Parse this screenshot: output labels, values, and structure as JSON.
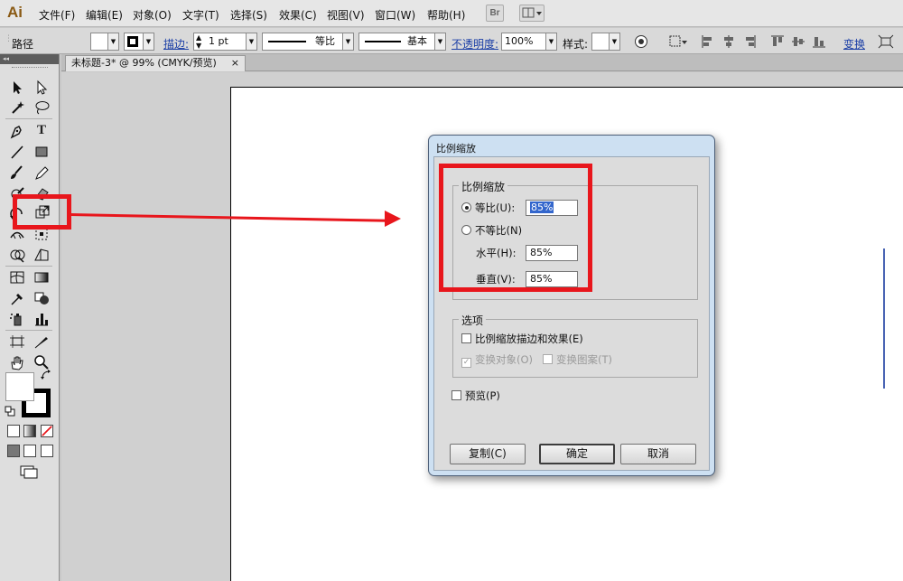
{
  "app": {
    "logo": "Ai"
  },
  "menus": [
    "文件(F)",
    "编辑(E)",
    "对象(O)",
    "文字(T)",
    "选择(S)",
    "效果(C)",
    "视图(V)",
    "窗口(W)",
    "帮助(H)"
  ],
  "menubar_buttons": {
    "bridge": "Br"
  },
  "control_bar": {
    "selection_label": "路径",
    "stroke_label": "描边:",
    "stroke_weight": "1 pt",
    "stroke_profile": "等比",
    "brush_def": "基本",
    "opacity_label": "不透明度:",
    "opacity_value": "100%",
    "style_label": "样式:",
    "transform_label": "变换"
  },
  "document_tab": {
    "title": "未标题-3* @ 99% (CMYK/预览)",
    "close": "×"
  },
  "toolbox": {
    "collapse": "◂◂"
  },
  "dialog": {
    "title": "比例缩放",
    "uniform_group": {
      "legend": "比例缩放",
      "uniform_label": "等比(U):",
      "uniform_value": "85%",
      "non_uniform_label": "不等比(N)",
      "horizontal_label": "水平(H):",
      "horizontal_value": "85%",
      "vertical_label": "垂直(V):",
      "vertical_value": "85%"
    },
    "options_group": {
      "legend": "选项",
      "scale_strokes": "比例缩放描边和效果(E)",
      "transform_objects": "变换对象(O)",
      "transform_patterns": "变换图案(T)"
    },
    "preview": "预览(P)",
    "buttons": {
      "copy": "复制(C)",
      "ok": "确定",
      "cancel": "取消"
    }
  },
  "colors": {
    "annotation_red": "#e8161c",
    "dialog_frame": "#cde0f2"
  }
}
